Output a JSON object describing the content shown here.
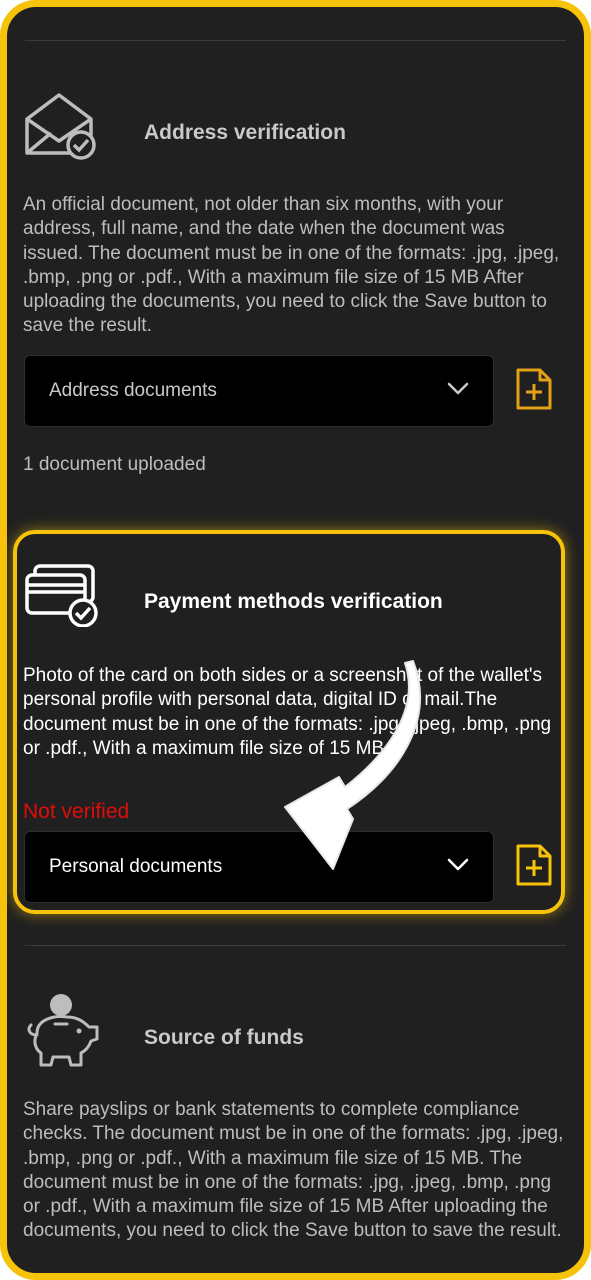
{
  "address_section": {
    "title": "Address verification",
    "icon": "envelope-check-icon",
    "description": "An official document, not older than six months, with your address, full name, and the date when the document was issued. The document must be in one of the formats: .jpg, .jpeg, .bmp, .png or .pdf., With a maximum file size of 15 MB After uploading the documents, you need to click the Save button to save the result.",
    "select_value": "Address documents",
    "uploaded_text": "1 document uploaded"
  },
  "payment_section": {
    "title": "Payment methods verification",
    "icon": "credit-cards-check-icon",
    "description": "Photo of the card on both sides or a screenshot of the wallet's personal profile with personal data, digital ID or mail.The document must be in one of the formats: .jpg, .jpeg, .bmp, .png or .pdf., With a maximum file size of 15 MB.",
    "status": "Not verified",
    "select_value": "Personal documents"
  },
  "funds_section": {
    "title": "Source of funds",
    "icon": "piggy-bank-icon",
    "description": "Share payslips or bank statements to complete compliance checks. The document must be in one of the formats: .jpg, .jpeg, .bmp, .png or .pdf., With a maximum file size of 15 MB. The document must be in one of the formats: .jpg, .jpeg, .bmp, .png or .pdf., With a maximum file size of 15 MB After uploading the documents, you need to click the Save button to save the result."
  },
  "colors": {
    "accent": "#f7c30a",
    "background": "#202020",
    "error": "#e00c0c",
    "upload_icon": "#e3a118"
  }
}
